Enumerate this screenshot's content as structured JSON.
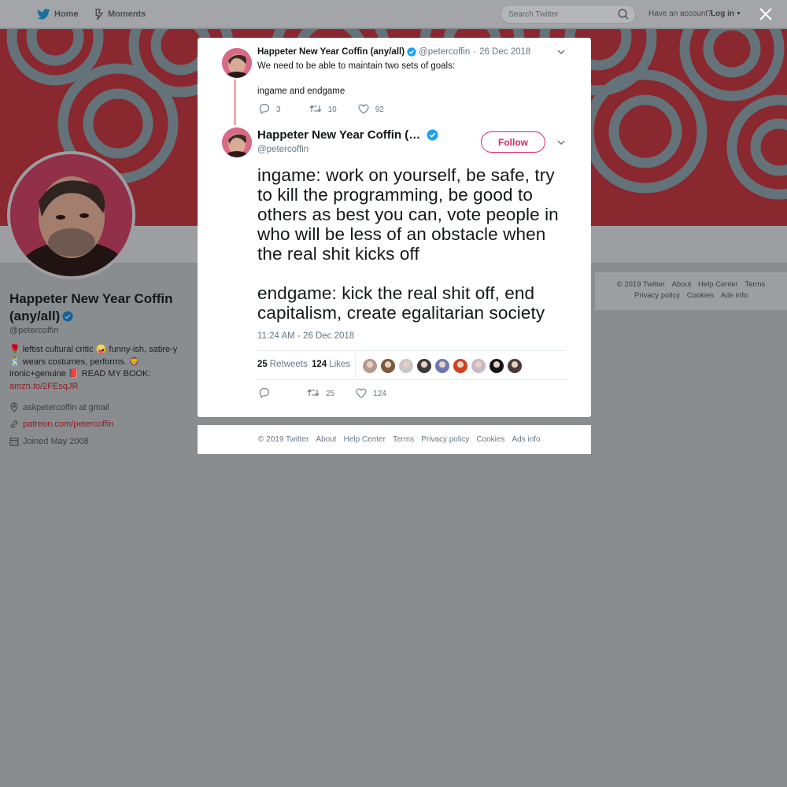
{
  "nav": {
    "home": "Home",
    "moments": "Moments",
    "search_placeholder": "Search Twitter",
    "have_account": "Have an account?",
    "login": "Log in"
  },
  "profile": {
    "name": "Happeter New Year Coffin (any/all)",
    "handle": "@petercoffin",
    "bio_line1": "🌹 leftist cultural critic 🤪 funny-ish, satire-y",
    "bio_line2": "🕺 wears costumes, performs. 🦁",
    "bio_line3": "ironic+genuine 📕 READ MY BOOK:",
    "bio_link": "amzn.to/2FEsqJR",
    "location": "askpetercoffin at gmail",
    "website": "patreon.com/petercoffin",
    "joined": "Joined May 2008"
  },
  "side_footer": {
    "line1": [
      "© 2019 Twitter",
      "About",
      "Help Center",
      "Terms"
    ],
    "line2": [
      "Privacy policy",
      "Cookies",
      "Ads info"
    ]
  },
  "parent_tweet": {
    "name": "Happeter New Year Coffin (any/all)",
    "handle": "@petercoffin",
    "sep": "·",
    "date": "26 Dec 2018",
    "line1": "We need to be able to maintain two sets of goals:",
    "line2": "ingame and endgame",
    "replies": "3",
    "retweets": "10",
    "likes": "92"
  },
  "main_tweet": {
    "name": "Happeter New Year Coffin (any/…",
    "handle": "@petercoffin",
    "follow": "Follow",
    "para1": "ingame: work on yourself, be safe, try to kill the programming, be good to others as best you can, vote people in who will be less of an obstacle when the real shit kicks off",
    "para2": "endgame: kick the real shit off, end capitalism, create egalitarian society",
    "timestamp": "11:24 AM - 26 Dec 2018",
    "retweet_count": "25",
    "retweet_label": "Retweets",
    "like_count": "124",
    "like_label": "Likes",
    "action_retweets": "25",
    "action_likes": "124",
    "liker_colors": [
      "#b39a8c",
      "#7a5a3a",
      "#c8c8c8",
      "#3a3a3a",
      "#6a7ab0",
      "#d04020",
      "#c9b8c8",
      "#151515",
      "#4a3a38"
    ]
  },
  "modal_footer": [
    "© 2019 Twitter",
    "About",
    "Help Center",
    "Terms",
    "Privacy policy",
    "Cookies",
    "Ads info"
  ],
  "colors": {
    "accent": "#e0245e",
    "verified": "#1da1f2",
    "link_dim": "#8e1e22"
  }
}
